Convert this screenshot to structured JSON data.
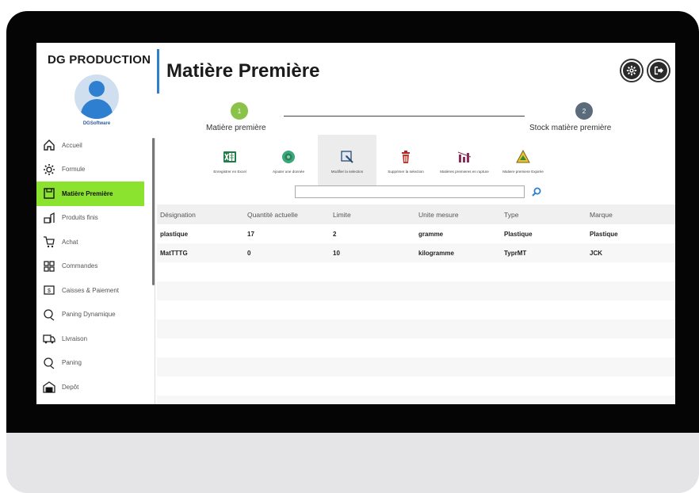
{
  "app": {
    "brand": "DG PRODUCTION",
    "company": "DGSoftware",
    "page_title": "Matière Première",
    "accent_color": "#2f7fd1",
    "active_color": "#8be32f"
  },
  "header_buttons": [
    {
      "icon": "gear-icon"
    },
    {
      "icon": "logout-icon"
    }
  ],
  "sidebar": {
    "items": [
      {
        "label": "Accueil",
        "icon": "home-icon"
      },
      {
        "label": "Formule",
        "icon": "gear-icon"
      },
      {
        "label": "Matière Première",
        "icon": "raw-material-icon",
        "active": true
      },
      {
        "label": "Produits finis",
        "icon": "product-icon"
      },
      {
        "label": "Achat",
        "icon": "cart-icon"
      },
      {
        "label": "Commandes",
        "icon": "orders-icon"
      },
      {
        "label": "Caisses & Paiement",
        "icon": "cash-register-icon"
      },
      {
        "label": "Paning Dynamique",
        "icon": "planning-icon"
      },
      {
        "label": "Livraison",
        "icon": "delivery-icon"
      },
      {
        "label": "Paning",
        "icon": "planning-icon"
      },
      {
        "label": "Depôt",
        "icon": "warehouse-icon"
      }
    ]
  },
  "steps": [
    {
      "number": "1",
      "label": "Matière première",
      "color": "#8bc34a"
    },
    {
      "number": "2",
      "label": "Stock matière première",
      "color": "#5b6b7c"
    }
  ],
  "toolbar": {
    "actions": [
      {
        "label": "Enregistrer en Excel",
        "icon": "excel-icon"
      },
      {
        "label": "Ajouter une donnée",
        "icon": "add-icon"
      },
      {
        "label": "Modifier la selection",
        "icon": "edit-icon",
        "selected": true
      },
      {
        "label": "Supprimer la selection",
        "icon": "trash-icon"
      },
      {
        "label": "Matières premieres en rupture",
        "icon": "stock-out-icon"
      },
      {
        "label": "Matiere premiere Expirée",
        "icon": "warning-icon"
      }
    ]
  },
  "search": {
    "value": "",
    "placeholder": ""
  },
  "table": {
    "columns": [
      "Désignation",
      "Quantité actuelle",
      "Limite",
      "Unite mesure",
      "Type",
      "Marque"
    ],
    "rows": [
      [
        "plastique",
        "17",
        "2",
        "gramme",
        "Plastique",
        "Plastique"
      ],
      [
        "MatTTTG",
        "0",
        "10",
        "kilogramme",
        "TyprMT",
        "JCK"
      ]
    ]
  }
}
